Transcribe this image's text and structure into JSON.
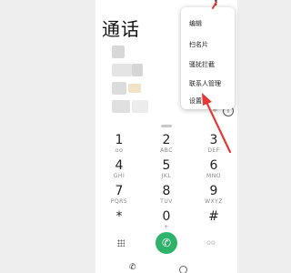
{
  "header": {
    "title": "通话"
  },
  "menu": {
    "items": [
      {
        "label": "编辑"
      },
      {
        "label": "扫名片"
      },
      {
        "label": "骚扰拦截"
      },
      {
        "label": "联系人管理"
      },
      {
        "label": "设置"
      }
    ]
  },
  "keypad": {
    "keys": [
      {
        "digit": "1",
        "sub": "ᴑᴑ"
      },
      {
        "digit": "2",
        "sub": "ABC"
      },
      {
        "digit": "3",
        "sub": "DEF"
      },
      {
        "digit": "4",
        "sub": "GHI"
      },
      {
        "digit": "5",
        "sub": "JKL"
      },
      {
        "digit": "6",
        "sub": "MNO"
      },
      {
        "digit": "7",
        "sub": "PQRS"
      },
      {
        "digit": "8",
        "sub": "TUV"
      },
      {
        "digit": "9",
        "sub": "WXYZ"
      },
      {
        "digit": "*",
        "sub": ""
      },
      {
        "digit": "0",
        "sub": "+"
      },
      {
        "digit": "#",
        "sub": ""
      }
    ]
  },
  "icons": {
    "call": "phone-icon",
    "more": "more-vertical-icon",
    "info": "info-icon",
    "dialpad": "dialpad-grid-icon",
    "voicemail": "voicemail-icon"
  },
  "colors": {
    "call_button": "#2fb36a",
    "arrow": "#e53935"
  }
}
